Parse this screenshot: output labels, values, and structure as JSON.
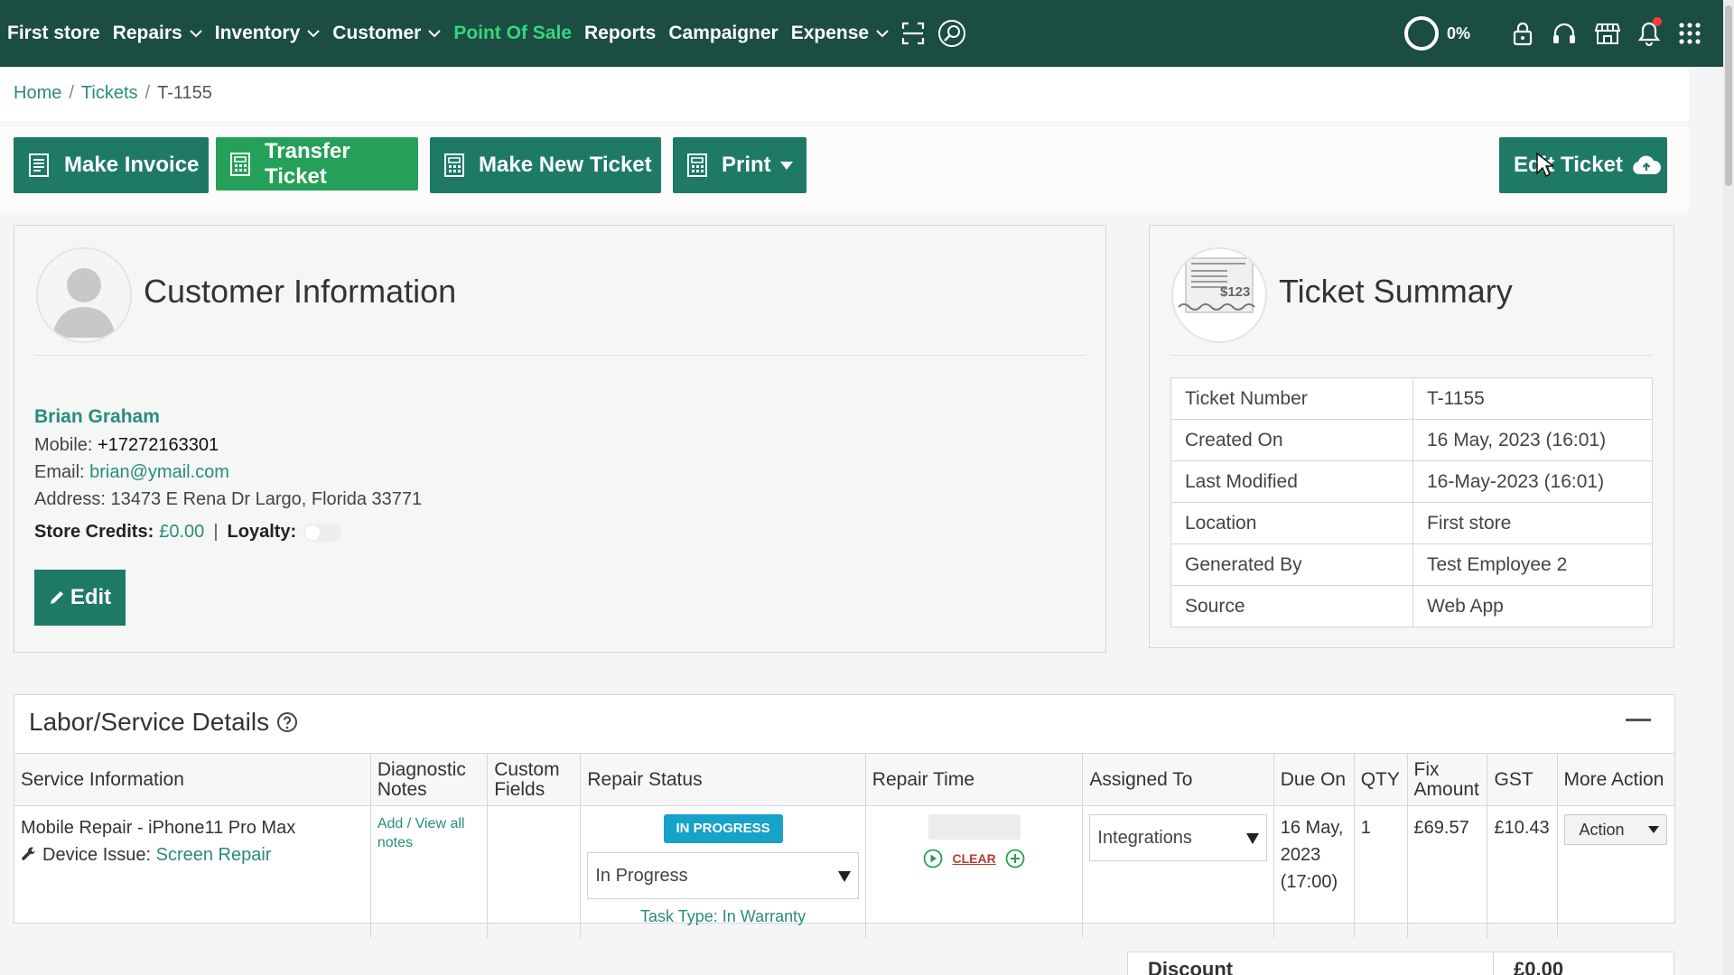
{
  "nav": {
    "brand": "First store",
    "items": [
      {
        "label": "Repairs",
        "dropdown": true
      },
      {
        "label": "Inventory",
        "dropdown": true
      },
      {
        "label": "Customer",
        "dropdown": true
      },
      {
        "label": "Point Of Sale",
        "active": true
      },
      {
        "label": "Reports"
      },
      {
        "label": "Campaigner"
      },
      {
        "label": "Expense",
        "dropdown": true
      }
    ],
    "icons": [
      "scan-icon",
      "search-icon"
    ],
    "progress": "0%",
    "right_icons": [
      "lock-icon",
      "headset-icon",
      "store-icon",
      "bell-icon",
      "apps-grid-icon"
    ]
  },
  "breadcrumb": {
    "home": "Home",
    "tickets": "Tickets",
    "current": "T-1155"
  },
  "actions": {
    "make_invoice": "Make Invoice",
    "transfer_ticket": "Transfer Ticket",
    "make_new_ticket": "Make New Ticket",
    "print": "Print",
    "edit_ticket": "Edit Ticket"
  },
  "customer": {
    "title": "Customer Information",
    "name": "Brian Graham",
    "mobile_label": "Mobile:",
    "mobile": "+17272163301",
    "email_label": "Email:",
    "email": "brian@ymail.com",
    "address_label": "Address:",
    "address": "13473 E Rena Dr Largo, Florida 33771",
    "credits_label": "Store Credits:",
    "credits": "£0.00",
    "pipe": "|",
    "loyalty_label": "Loyalty:",
    "edit_label": "Edit"
  },
  "summary": {
    "title": "Ticket Summary",
    "rows": [
      {
        "label": "Ticket Number",
        "value": "T-1155"
      },
      {
        "label": "Created On",
        "value": "16 May, 2023 (16:01)"
      },
      {
        "label": "Last Modified",
        "value": "16-May-2023 (16:01)"
      },
      {
        "label": "Location",
        "value": "First store"
      },
      {
        "label": "Generated By",
        "value": "Test Employee 2"
      },
      {
        "label": "Source",
        "value": "Web App"
      }
    ]
  },
  "services": {
    "title": "Labor/Service Details",
    "headers": [
      "Service Information",
      "Diagnostic Notes",
      "Custom Fields",
      "Repair Status",
      "Repair Time",
      "Assigned To",
      "Due On",
      "QTY",
      "Fix Amount",
      "GST",
      "More Action"
    ],
    "row": {
      "service": "Mobile Repair - iPhone11 Pro Max",
      "issue_label": "Device Issue:",
      "issue": "Screen Repair",
      "notes_link": "Add / View all notes",
      "status_badge": "IN PROGRESS",
      "status_select": "In Progress",
      "task_type": "Task Type: In Warranty",
      "clear_label": "CLEAR",
      "assigned": "Integrations",
      "due_on": "16 May, 2023 (17:00)",
      "qty": "1",
      "fix_amount": "£69.57",
      "gst": "£10.43",
      "action_label": "Action"
    }
  },
  "discount": {
    "label": "Discount",
    "value": "£0.00"
  }
}
